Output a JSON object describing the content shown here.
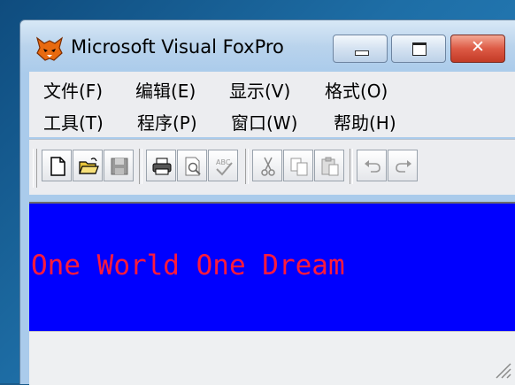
{
  "window": {
    "title": "Microsoft Visual FoxPro",
    "icon": "foxpro-fox-icon",
    "caption_buttons": {
      "minimize": "minimize",
      "maximize": "maximize",
      "close": "✕"
    }
  },
  "menu": {
    "row1": [
      {
        "label": "文件(F)"
      },
      {
        "label": "编辑(E)"
      },
      {
        "label": "显示(V)"
      },
      {
        "label": "格式(O)"
      }
    ],
    "row2": [
      {
        "label": "工具(T)"
      },
      {
        "label": "程序(P)"
      },
      {
        "label": "窗口(W)"
      },
      {
        "label": "帮助(H)"
      }
    ]
  },
  "toolbar": {
    "buttons": [
      "new-file-icon",
      "open-folder-icon",
      "save-icon",
      "print-icon",
      "print-preview-icon",
      "spell-check-icon",
      "cut-icon",
      "copy-icon",
      "paste-icon",
      "undo-icon",
      "redo-icon"
    ]
  },
  "document": {
    "text": "One World One Dream",
    "background": "#0000ff",
    "text_color": "#ff1a3c"
  }
}
